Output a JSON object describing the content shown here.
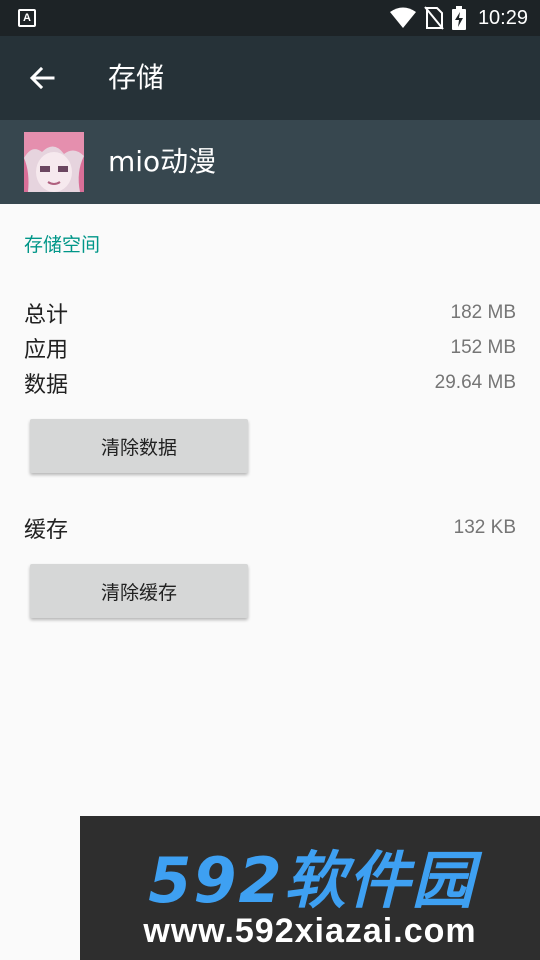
{
  "status_bar": {
    "left_icon_text": "A",
    "time": "10:29"
  },
  "toolbar": {
    "title": "存储"
  },
  "app": {
    "name": "mio动漫"
  },
  "storage": {
    "section_title": "存储空间",
    "rows": [
      {
        "label": "总计",
        "value": "182 MB"
      },
      {
        "label": "应用",
        "value": "152 MB"
      },
      {
        "label": "数据",
        "value": "29.64 MB"
      }
    ],
    "clear_data_label": "清除数据"
  },
  "cache": {
    "label": "缓存",
    "value": "132 KB",
    "clear_cache_label": "清除缓存"
  },
  "watermark": {
    "title": "592软件园",
    "url": "www.592xiazai.com"
  },
  "colors": {
    "toolbar": "#263238",
    "app_row": "#37474f",
    "accent": "#009688",
    "button": "#d6d7d7"
  }
}
